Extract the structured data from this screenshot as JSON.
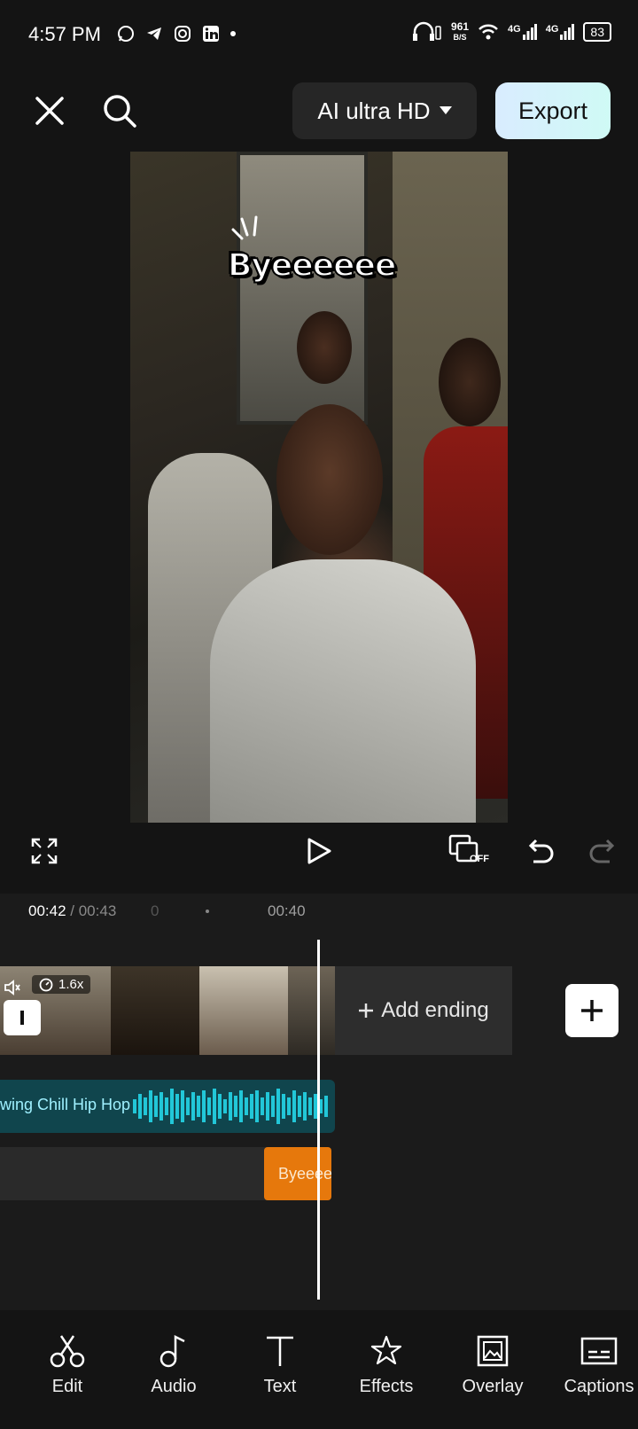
{
  "status": {
    "time": "4:57 PM",
    "net_speed_value": "961",
    "net_speed_unit": "B/S",
    "signal1": "4G",
    "signal2": "4G",
    "battery": "83"
  },
  "topbar": {
    "resolution_label": "AI ultra HD",
    "export_label": "Export"
  },
  "preview": {
    "sticker_text": "Byeeeeee"
  },
  "controls": {
    "off_label": "OFF"
  },
  "timeline": {
    "current_time": "00:42",
    "total_time": "/ 00:43",
    "left_tick": "0",
    "tick_label": "00:40",
    "speed_label": "1.6x",
    "add_ending_label": "Add ending",
    "audio_track_label": "wing Chill Hip Hop",
    "text_clip_label": "Byeeee"
  },
  "nav": {
    "items": [
      {
        "label": "Edit"
      },
      {
        "label": "Audio"
      },
      {
        "label": "Text"
      },
      {
        "label": "Effects"
      },
      {
        "label": "Overlay"
      },
      {
        "label": "Captions"
      }
    ]
  }
}
